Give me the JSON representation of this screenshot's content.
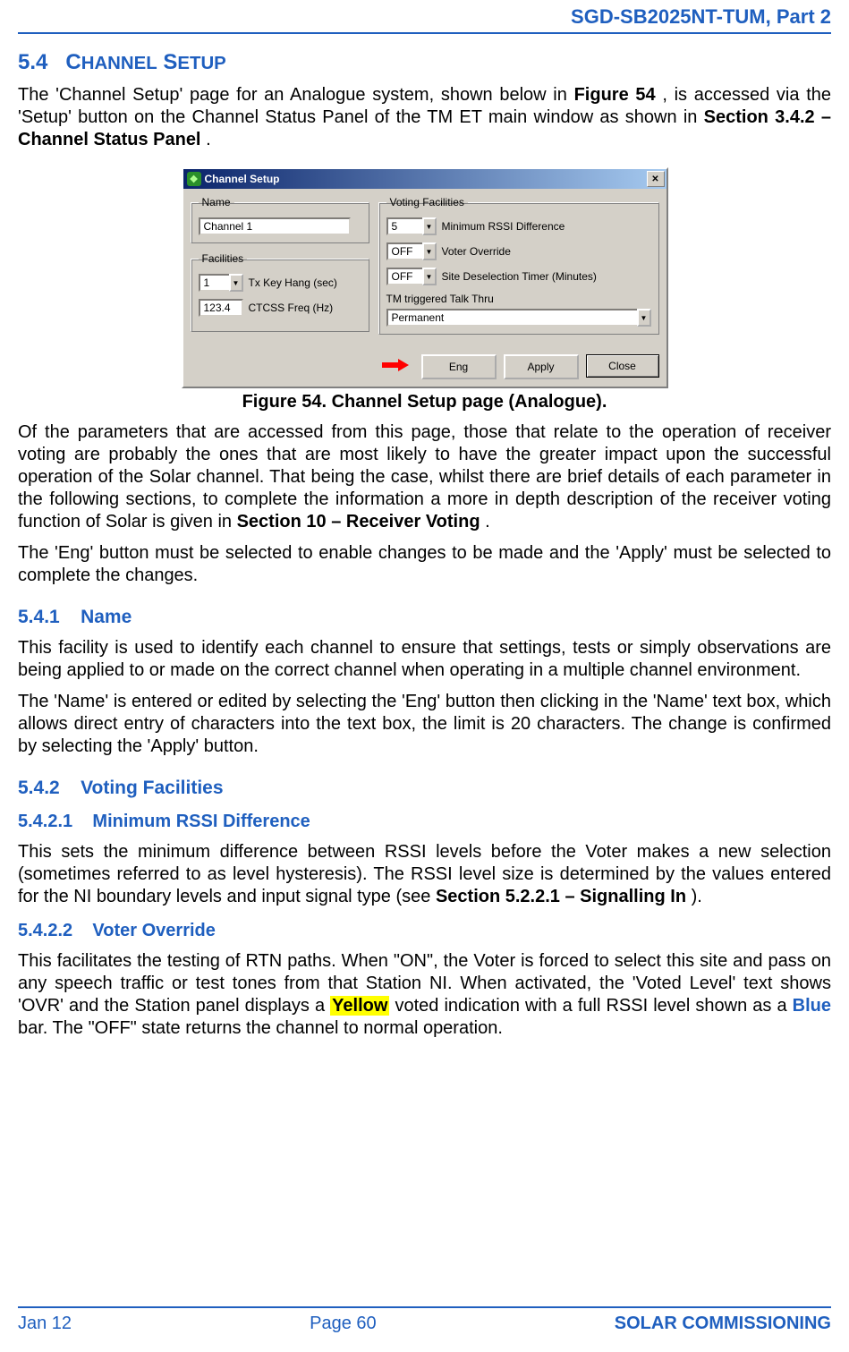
{
  "header": {
    "doc_id": "SGD-SB2025NT-TUM, Part 2"
  },
  "section": {
    "number": "5.4",
    "title": "CHANNEL SETUP",
    "intro_parts": {
      "p1a": "The 'Channel Setup' page for an Analogue system, shown below in ",
      "p1_fig": "Figure 54",
      "p1b": ", is accessed via the 'Setup' button on the Channel Status Panel of the TM ET main window as shown in ",
      "p1_sec": "Section 3.4.2 – Channel Status Panel",
      "p1c": "."
    }
  },
  "dialog": {
    "title": "Channel Setup",
    "name_group": {
      "legend": "Name",
      "value": "Channel 1"
    },
    "facilities_group": {
      "legend": "Facilities",
      "tx_key_hang": {
        "value": "1",
        "label": "Tx Key Hang (sec)"
      },
      "ctcss": {
        "value": "123.4",
        "label": "CTCSS Freq (Hz)"
      }
    },
    "voting_group": {
      "legend": "Voting Facilities",
      "min_rssi": {
        "value": "5",
        "label": "Minimum RSSI Difference"
      },
      "voter_override": {
        "value": "OFF",
        "label": "Voter Override"
      },
      "site_desel": {
        "value": "OFF",
        "label": "Site Deselection Timer (Minutes)"
      },
      "talk_thru": {
        "label": "TM triggered Talk Thru",
        "value": "Permanent"
      }
    },
    "buttons": {
      "eng": "Eng",
      "apply": "Apply",
      "close": "Close"
    }
  },
  "figure_caption": "Figure 54.  Channel Setup page (Analogue).",
  "para2": {
    "a": "Of the parameters that are accessed from this page, those that relate to the operation of receiver voting are probably the ones that are most likely to have the greater impact upon the successful operation of the Solar channel.  That being the case, whilst there are brief details of each parameter in the following sections, to complete the information a more in depth description of the receiver voting function of Solar is given in ",
    "b": "Section 10 – Receiver Voting",
    "c": "."
  },
  "para3": "The 'Eng' button must be selected to enable changes to be made and the 'Apply' must be selected to complete the changes.",
  "s541": {
    "num": "5.4.1",
    "title": "Name",
    "p1": "This facility is used to identify each channel to ensure that settings, tests or simply observations are being applied to or made on the correct channel when operating in a multiple channel environment.",
    "p2": "The 'Name' is entered or edited by selecting the 'Eng' button then clicking in the 'Name' text box, which allows direct entry of characters into the text box, the limit is 20 characters.  The change is confirmed by selecting the 'Apply' button."
  },
  "s542": {
    "num": "5.4.2",
    "title": "Voting Facilities",
    "s1": {
      "num": "5.4.2.1",
      "title": "Minimum RSSI Difference",
      "p_a": "This sets the minimum difference between RSSI levels before the Voter makes a new selection (sometimes referred to as level hysteresis).  The RSSI level size is determined by the values entered for the NI boundary levels and input signal type (see ",
      "p_b": "Section 5.2.2.1 – Signalling In",
      "p_c": ")."
    },
    "s2": {
      "num": "5.4.2.2",
      "title": "Voter Override",
      "p_a": "This facilitates the testing of RTN paths.  When \"ON\", the Voter is forced to select this site and pass on any speech traffic or test tones from that Station NI.  When activated, the 'Voted Level' text shows 'OVR' and the Station panel displays a ",
      "p_yellow": "Yellow",
      "p_b": " voted indication with a full RSSI level shown as a ",
      "p_blue": "Blue",
      "p_c": " bar.  The \"OFF\" state returns the channel to normal operation."
    }
  },
  "footer": {
    "left": "Jan 12",
    "center": "Page 60",
    "right": "SOLAR COMMISSIONING"
  }
}
